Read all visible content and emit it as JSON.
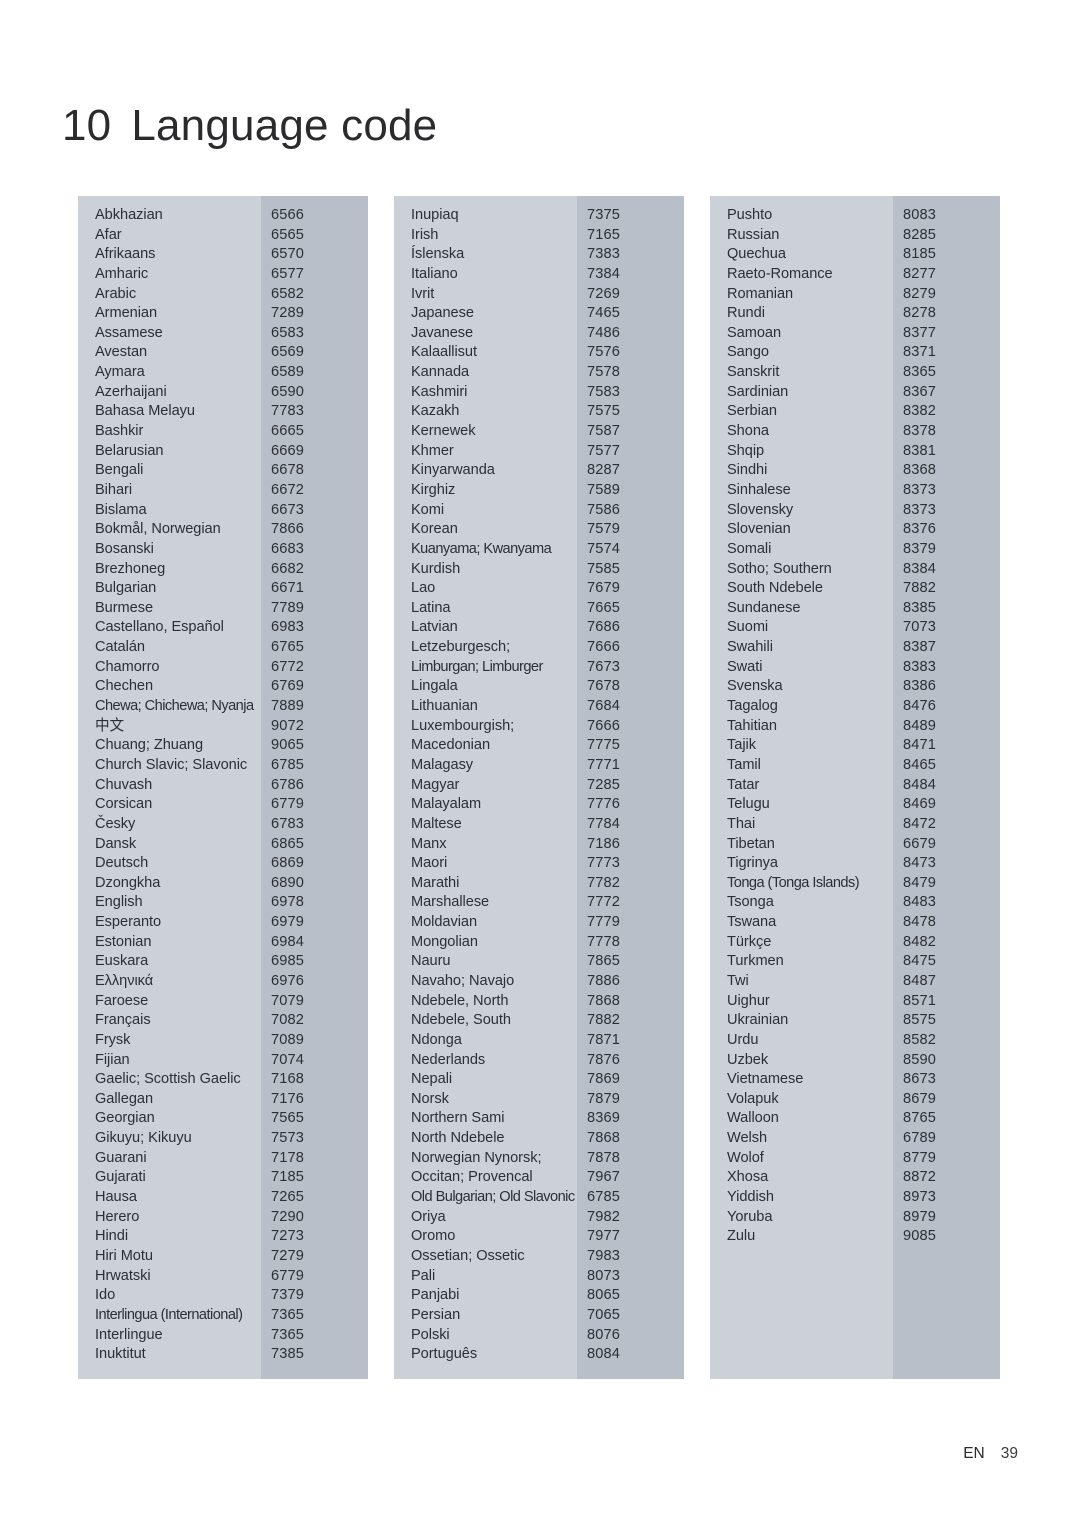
{
  "page": {
    "chapter_number": "10",
    "title": "Language code",
    "footer_language": "EN",
    "footer_page": "39",
    "colors": {
      "name_column_bg": "#ccd1d8",
      "code_column_bg": "#b9bfc9",
      "text": "#2c2f33",
      "heading": "#2b2b2e",
      "page_bg": "#ffffff"
    }
  },
  "columns": [
    {
      "id": "column-1",
      "rows": [
        {
          "name": "Abkhazian",
          "code": "6566"
        },
        {
          "name": "Afar",
          "code": "6565"
        },
        {
          "name": "Afrikaans",
          "code": "6570"
        },
        {
          "name": "Amharic",
          "code": "6577"
        },
        {
          "name": "Arabic",
          "code": "6582"
        },
        {
          "name": "Armenian",
          "code": "7289"
        },
        {
          "name": "Assamese",
          "code": "6583"
        },
        {
          "name": "Avestan",
          "code": "6569"
        },
        {
          "name": "Aymara",
          "code": "6589"
        },
        {
          "name": "Azerhaijani",
          "code": "6590"
        },
        {
          "name": "Bahasa Melayu",
          "code": "7783"
        },
        {
          "name": "Bashkir",
          "code": "6665"
        },
        {
          "name": "Belarusian",
          "code": "6669"
        },
        {
          "name": "Bengali",
          "code": "6678"
        },
        {
          "name": "Bihari",
          "code": "6672"
        },
        {
          "name": "Bislama",
          "code": "6673"
        },
        {
          "name": "Bokmål, Norwegian",
          "code": "7866"
        },
        {
          "name": "Bosanski",
          "code": "6683"
        },
        {
          "name": "Brezhoneg",
          "code": "6682"
        },
        {
          "name": "Bulgarian",
          "code": "6671"
        },
        {
          "name": "Burmese",
          "code": "7789"
        },
        {
          "name": "Castellano, Español",
          "code": "6983"
        },
        {
          "name": "Catalán",
          "code": "6765"
        },
        {
          "name": "Chamorro",
          "code": "6772"
        },
        {
          "name": "Chechen",
          "code": "6769"
        },
        {
          "name": "Chewa; Chichewa; Nyanja",
          "code": "7889",
          "tight": true
        },
        {
          "name": "中文",
          "code": "9072"
        },
        {
          "name": "Chuang; Zhuang",
          "code": "9065"
        },
        {
          "name": "Church Slavic; Slavonic",
          "code": "6785"
        },
        {
          "name": "Chuvash",
          "code": "6786"
        },
        {
          "name": "Corsican",
          "code": "6779"
        },
        {
          "name": "Česky",
          "code": "6783"
        },
        {
          "name": "Dansk",
          "code": "6865"
        },
        {
          "name": "Deutsch",
          "code": "6869"
        },
        {
          "name": "Dzongkha",
          "code": "6890"
        },
        {
          "name": "English",
          "code": "6978"
        },
        {
          "name": "Esperanto",
          "code": "6979"
        },
        {
          "name": "Estonian",
          "code": "6984"
        },
        {
          "name": "Euskara",
          "code": "6985"
        },
        {
          "name": "Ελληνικά",
          "code": "6976"
        },
        {
          "name": "Faroese",
          "code": "7079"
        },
        {
          "name": "Français",
          "code": "7082"
        },
        {
          "name": "Frysk",
          "code": "7089"
        },
        {
          "name": "Fijian",
          "code": "7074"
        },
        {
          "name": "Gaelic; Scottish Gaelic",
          "code": "7168"
        },
        {
          "name": "Gallegan",
          "code": "7176"
        },
        {
          "name": "Georgian",
          "code": "7565"
        },
        {
          "name": "Gikuyu; Kikuyu",
          "code": "7573"
        },
        {
          "name": "Guarani",
          "code": "7178"
        },
        {
          "name": "Gujarati",
          "code": "7185"
        },
        {
          "name": "Hausa",
          "code": "7265"
        },
        {
          "name": "Herero",
          "code": "7290"
        },
        {
          "name": "Hindi",
          "code": "7273"
        },
        {
          "name": "Hiri Motu",
          "code": "7279"
        },
        {
          "name": "Hrwatski",
          "code": "6779"
        },
        {
          "name": "Ido",
          "code": "7379"
        },
        {
          "name": "Interlingua (International)",
          "code": "7365",
          "tight": true
        },
        {
          "name": "Interlingue",
          "code": "7365"
        },
        {
          "name": "Inuktitut",
          "code": "7385"
        }
      ]
    },
    {
      "id": "column-2",
      "rows": [
        {
          "name": "Inupiaq",
          "code": "7375"
        },
        {
          "name": "Irish",
          "code": "7165"
        },
        {
          "name": "Íslenska",
          "code": "7383"
        },
        {
          "name": "Italiano",
          "code": "7384"
        },
        {
          "name": "Ivrit",
          "code": "7269"
        },
        {
          "name": "Japanese",
          "code": "7465"
        },
        {
          "name": "Javanese",
          "code": "7486"
        },
        {
          "name": "Kalaallisut",
          "code": "7576"
        },
        {
          "name": "Kannada",
          "code": "7578"
        },
        {
          "name": "Kashmiri",
          "code": "7583"
        },
        {
          "name": "Kazakh",
          "code": "7575"
        },
        {
          "name": "Kernewek",
          "code": "7587"
        },
        {
          "name": "Khmer",
          "code": "7577"
        },
        {
          "name": "Kinyarwanda",
          "code": "8287"
        },
        {
          "name": "Kirghiz",
          "code": "7589"
        },
        {
          "name": "Komi",
          "code": "7586"
        },
        {
          "name": "Korean",
          "code": "7579"
        },
        {
          "name": "Kuanyama; Kwanyama",
          "code": "7574",
          "tight": true
        },
        {
          "name": "Kurdish",
          "code": "7585"
        },
        {
          "name": "Lao",
          "code": "7679"
        },
        {
          "name": "Latina",
          "code": "7665"
        },
        {
          "name": "Latvian",
          "code": "7686"
        },
        {
          "name": "Letzeburgesch;",
          "code": "7666"
        },
        {
          "name": "Limburgan; Limburger",
          "code": "7673",
          "tight": true
        },
        {
          "name": "Lingala",
          "code": "7678"
        },
        {
          "name": "Lithuanian",
          "code": "7684"
        },
        {
          "name": "Luxembourgish;",
          "code": "7666"
        },
        {
          "name": "Macedonian",
          "code": "7775"
        },
        {
          "name": "Malagasy",
          "code": "7771"
        },
        {
          "name": "Magyar",
          "code": "7285"
        },
        {
          "name": "Malayalam",
          "code": "7776"
        },
        {
          "name": "Maltese",
          "code": "7784"
        },
        {
          "name": "Manx",
          "code": "7186"
        },
        {
          "name": "Maori",
          "code": "7773"
        },
        {
          "name": "Marathi",
          "code": "7782"
        },
        {
          "name": "Marshallese",
          "code": "7772"
        },
        {
          "name": "Moldavian",
          "code": "7779"
        },
        {
          "name": "Mongolian",
          "code": "7778"
        },
        {
          "name": "Nauru",
          "code": "7865"
        },
        {
          "name": "Navaho; Navajo",
          "code": "7886"
        },
        {
          "name": "Ndebele, North",
          "code": "7868"
        },
        {
          "name": "Ndebele, South",
          "code": "7882"
        },
        {
          "name": "Ndonga",
          "code": "7871"
        },
        {
          "name": "Nederlands",
          "code": "7876"
        },
        {
          "name": "Nepali",
          "code": "7869"
        },
        {
          "name": "Norsk",
          "code": "7879"
        },
        {
          "name": "Northern Sami",
          "code": "8369"
        },
        {
          "name": "North Ndebele",
          "code": "7868"
        },
        {
          "name": "Norwegian Nynorsk;",
          "code": "7878"
        },
        {
          "name": "Occitan; Provencal",
          "code": "7967"
        },
        {
          "name": "Old Bulgarian; Old Slavonic",
          "code": "6785",
          "tight": true
        },
        {
          "name": "Oriya",
          "code": "7982"
        },
        {
          "name": "Oromo",
          "code": "7977"
        },
        {
          "name": "Ossetian; Ossetic",
          "code": "7983"
        },
        {
          "name": "Pali",
          "code": "8073"
        },
        {
          "name": "Panjabi",
          "code": "8065"
        },
        {
          "name": "Persian",
          "code": "7065"
        },
        {
          "name": "Polski",
          "code": "8076"
        },
        {
          "name": "Português",
          "code": "8084"
        }
      ]
    },
    {
      "id": "column-3",
      "rows": [
        {
          "name": "Pushto",
          "code": "8083"
        },
        {
          "name": "Russian",
          "code": "8285"
        },
        {
          "name": "Quechua",
          "code": "8185"
        },
        {
          "name": "Raeto-Romance",
          "code": "8277"
        },
        {
          "name": "Romanian",
          "code": "8279"
        },
        {
          "name": "Rundi",
          "code": "8278"
        },
        {
          "name": "Samoan",
          "code": "8377"
        },
        {
          "name": "Sango",
          "code": "8371"
        },
        {
          "name": "Sanskrit",
          "code": "8365"
        },
        {
          "name": "Sardinian",
          "code": "8367"
        },
        {
          "name": "Serbian",
          "code": "8382"
        },
        {
          "name": "Shona",
          "code": "8378"
        },
        {
          "name": "Shqip",
          "code": "8381"
        },
        {
          "name": "Sindhi",
          "code": "8368"
        },
        {
          "name": "Sinhalese",
          "code": "8373"
        },
        {
          "name": "Slovensky",
          "code": "8373"
        },
        {
          "name": "Slovenian",
          "code": "8376"
        },
        {
          "name": "Somali",
          "code": "8379"
        },
        {
          "name": "Sotho; Southern",
          "code": "8384"
        },
        {
          "name": "South Ndebele",
          "code": "7882"
        },
        {
          "name": "Sundanese",
          "code": "8385"
        },
        {
          "name": "Suomi",
          "code": "7073"
        },
        {
          "name": "Swahili",
          "code": "8387"
        },
        {
          "name": "Swati",
          "code": "8383"
        },
        {
          "name": "Svenska",
          "code": "8386"
        },
        {
          "name": "Tagalog",
          "code": "8476"
        },
        {
          "name": "Tahitian",
          "code": "8489"
        },
        {
          "name": "Tajik",
          "code": "8471"
        },
        {
          "name": "Tamil",
          "code": "8465"
        },
        {
          "name": "Tatar",
          "code": "8484"
        },
        {
          "name": "Telugu",
          "code": "8469"
        },
        {
          "name": "Thai",
          "code": "8472"
        },
        {
          "name": "Tibetan",
          "code": "6679"
        },
        {
          "name": "Tigrinya",
          "code": "8473"
        },
        {
          "name": "Tonga (Tonga Islands)",
          "code": "8479",
          "tight": true
        },
        {
          "name": "Tsonga",
          "code": "8483"
        },
        {
          "name": "Tswana",
          "code": "8478"
        },
        {
          "name": "Türkçe",
          "code": "8482"
        },
        {
          "name": "Turkmen",
          "code": "8475"
        },
        {
          "name": "Twi",
          "code": "8487"
        },
        {
          "name": "Uighur",
          "code": "8571"
        },
        {
          "name": "Ukrainian",
          "code": "8575"
        },
        {
          "name": "Urdu",
          "code": "8582"
        },
        {
          "name": "Uzbek",
          "code": "8590"
        },
        {
          "name": "Vietnamese",
          "code": "8673"
        },
        {
          "name": "Volapuk",
          "code": "8679"
        },
        {
          "name": "Walloon",
          "code": "8765"
        },
        {
          "name": "Welsh",
          "code": "6789"
        },
        {
          "name": "Wolof",
          "code": "8779"
        },
        {
          "name": "Xhosa",
          "code": "8872"
        },
        {
          "name": "Yiddish",
          "code": "8973"
        },
        {
          "name": "Yoruba",
          "code": "8979"
        },
        {
          "name": "Zulu",
          "code": "9085"
        }
      ]
    }
  ]
}
